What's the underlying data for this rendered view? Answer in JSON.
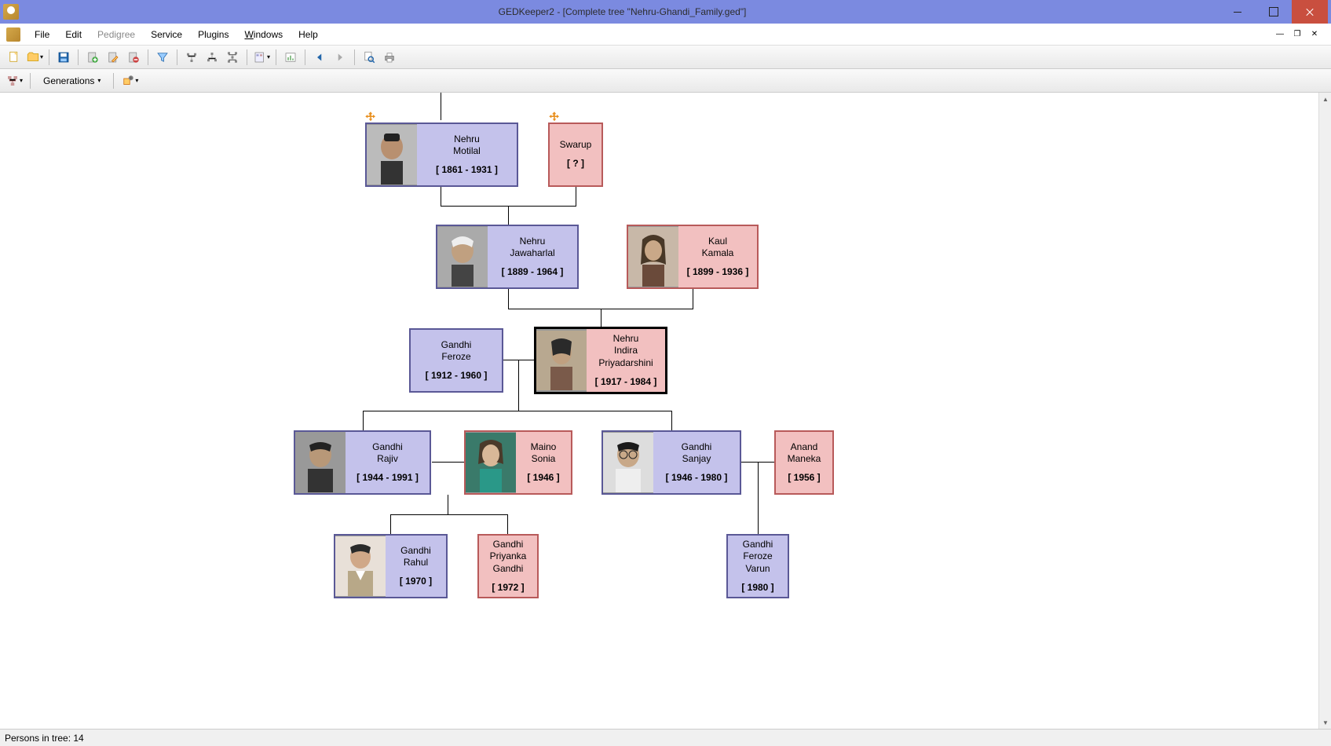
{
  "title": "GEDKeeper2 - [Complete tree \"Nehru-Ghandi_Family.ged\"]",
  "menu": {
    "file": "File",
    "edit": "Edit",
    "pedigree": "Pedigree",
    "service": "Service",
    "plugins": "Plugins",
    "windows": "Windows",
    "help": "Help"
  },
  "toolbar2": {
    "generations": "Generations"
  },
  "people": {
    "motilal": {
      "name1": "Nehru",
      "name2": "Motilal",
      "dates": "[ 1861 - 1931 ]"
    },
    "swarup": {
      "name1": "Swarup",
      "dates": "[ ? ]"
    },
    "jawaharlal": {
      "name1": "Nehru",
      "name2": "Jawaharlal",
      "dates": "[ 1889 - 1964 ]"
    },
    "kamala": {
      "name1": "Kaul",
      "name2": "Kamala",
      "dates": "[ 1899 - 1936 ]"
    },
    "feroze": {
      "name1": "Gandhi",
      "name2": "Feroze",
      "dates": "[ 1912 - 1960 ]"
    },
    "indira": {
      "name1": "Nehru",
      "name2": "Indira",
      "name3": "Priyadarshini",
      "dates": "[ 1917 - 1984 ]"
    },
    "rajiv": {
      "name1": "Gandhi",
      "name2": "Rajiv",
      "dates": "[ 1944 - 1991 ]"
    },
    "sonia": {
      "name1": "Maino",
      "name2": "Sonia",
      "dates": "[ 1946 ]"
    },
    "sanjay": {
      "name1": "Gandhi",
      "name2": "Sanjay",
      "dates": "[ 1946 - 1980 ]"
    },
    "maneka": {
      "name1": "Anand",
      "name2": "Maneka",
      "dates": "[ 1956 ]"
    },
    "rahul": {
      "name1": "Gandhi",
      "name2": "Rahul",
      "dates": "[ 1970 ]"
    },
    "priyanka": {
      "name1": "Gandhi",
      "name2": "Priyanka",
      "name3": "Gandhi",
      "dates": "[ 1972 ]"
    },
    "varun": {
      "name1": "Gandhi",
      "name2": "Feroze",
      "name3": "Varun",
      "dates": "[ 1980 ]"
    }
  },
  "status": {
    "persons": "Persons in tree: 14"
  }
}
